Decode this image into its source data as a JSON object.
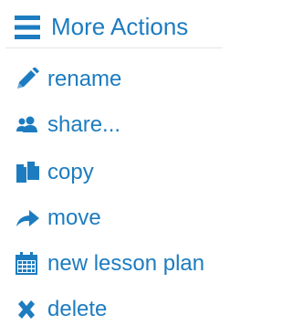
{
  "header": {
    "title": "More Actions",
    "icon": "hamburger-menu-icon"
  },
  "accent_color": "#1d7cc0",
  "menu": {
    "items": [
      {
        "label": "rename",
        "icon": "pencil-icon"
      },
      {
        "label": "share...",
        "icon": "users-icon"
      },
      {
        "label": "copy",
        "icon": "copy-document-icon"
      },
      {
        "label": "move",
        "icon": "forward-arrow-icon"
      },
      {
        "label": "new lesson plan",
        "icon": "calendar-icon"
      },
      {
        "label": "delete",
        "icon": "x-mark-icon"
      }
    ]
  }
}
